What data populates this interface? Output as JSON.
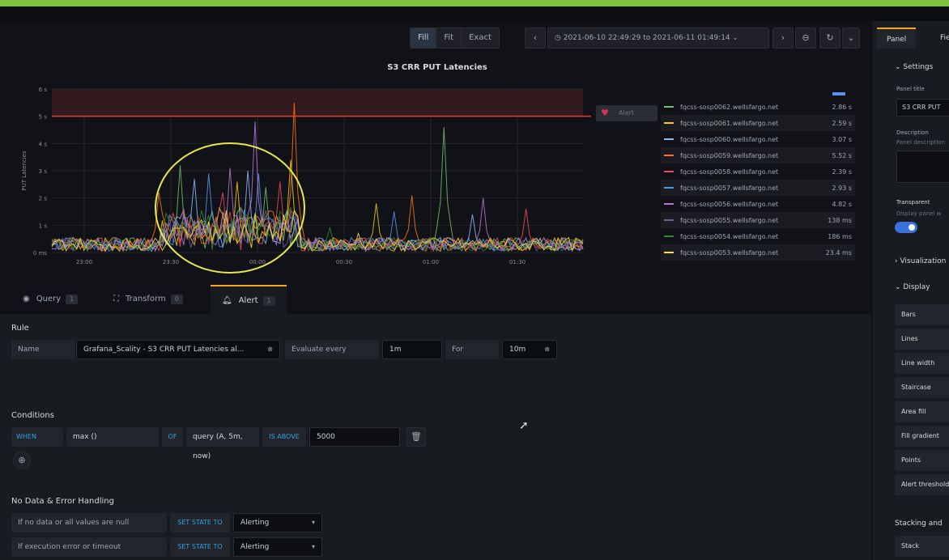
{
  "toolbar": {
    "view_buttons": [
      "Fill",
      "Fit",
      "Exact"
    ],
    "time_range": "2021-06-10 22:49:29 to 2021-06-11 01:49:14",
    "prev_icon": "chevron-left-icon",
    "next_icon": "chevron-right-icon",
    "zoom_icon": "zoom-out-icon",
    "refresh_icon": "refresh-icon",
    "more_icon": "chevron-down-icon"
  },
  "chart": {
    "title": "S3 CRR PUT Latencies"
  },
  "chart_data": {
    "type": "line",
    "title": "S3 CRR PUT Latencies",
    "ylabel": "PUT Latencies",
    "xlabel": "",
    "x_ticks": [
      "23:00",
      "23:30",
      "00:00",
      "00:30",
      "01:00",
      "01:30"
    ],
    "y_ticks": [
      "0 ms",
      "1 s",
      "2 s",
      "3 s",
      "4 s",
      "5 s",
      "6 s"
    ],
    "ylim": [
      0,
      6
    ],
    "threshold": 5,
    "grid": true,
    "legend_placement": "right",
    "series": [
      {
        "name": "fqcss-sosp0062.wellsfargo.net",
        "value": "2.86 s",
        "color": "#73bf69"
      },
      {
        "name": "fqcss-sosp0061.wellsfargo.net",
        "value": "2.59 s",
        "color": "#f2cc0c"
      },
      {
        "name": "fqcss-sosp0060.wellsfargo.net",
        "value": "3.07 s",
        "color": "#8ab8ff"
      },
      {
        "name": "fqcss-sosp0059.wellsfargo.net",
        "value": "5.52 s",
        "color": "#ff780a"
      },
      {
        "name": "fqcss-sosp0058.wellsfargo.net",
        "value": "2.39 s",
        "color": "#f2495c"
      },
      {
        "name": "fqcss-sosp0057.wellsfargo.net",
        "value": "2.93 s",
        "color": "#5794f2"
      },
      {
        "name": "fqcss-sosp0056.wellsfargo.net",
        "value": "4.82 s",
        "color": "#b877d9"
      },
      {
        "name": "fqcss-sosp0055.wellsfargo.net",
        "value": "138 ms",
        "color": "#705da0"
      },
      {
        "name": "fqcss-sosp0054.wellsfargo.net",
        "value": "186 ms",
        "color": "#37872d"
      },
      {
        "name": "fqcss-sosp0053.wellsfargo.net",
        "value": "23.4 ms",
        "color": "#fade2a"
      }
    ]
  },
  "alert_tag": {
    "label": "Alert",
    "icon": "heart-icon"
  },
  "tabs": [
    {
      "label": "Query",
      "count": "1",
      "icon": "database-icon"
    },
    {
      "label": "Transform",
      "count": "0",
      "icon": "transform-icon"
    },
    {
      "label": "Alert",
      "count": "1",
      "icon": "bell-icon"
    }
  ],
  "rule": {
    "section": "Rule",
    "name_label": "Name",
    "name_value": "Grafana_Scality - S3 CRR PUT Latencies al...",
    "evaluate_label": "Evaluate every",
    "evaluate_value": "1m",
    "for_label": "For",
    "for_value": "10m"
  },
  "conditions": {
    "section": "Conditions",
    "when": "WHEN",
    "func": "max ()",
    "of": "OF",
    "query": "query (A, 5m, now)",
    "is_above": "IS ABOVE",
    "value": "5000",
    "delete_icon": "trash-icon",
    "add_icon": "plus-circle-icon"
  },
  "nodata": {
    "section": "No Data & Error Handling",
    "rows": [
      {
        "label": "If no data or all values are null",
        "kw": "SET STATE TO",
        "value": "Alerting"
      },
      {
        "label": "If execution error or timeout",
        "kw": "SET STATE TO",
        "value": "Alerting"
      }
    ]
  },
  "sidepanel": {
    "tabs": [
      "Panel",
      "Fie"
    ],
    "settings": "Settings",
    "panel_title_label": "Panel title",
    "panel_title_value": "S3 CRR PUT",
    "description_label": "Description",
    "description_placeholder": "Panel description",
    "transparent_label": "Transparent",
    "transparent_hint": "Display panel w",
    "visualization": "Visualization",
    "display": "Display",
    "display_rows": [
      "Bars",
      "Lines",
      "Line width",
      "Staircase",
      "Area fill",
      "Fill gradient",
      "Points",
      "Alert thresholds"
    ],
    "stacking": "Stacking and",
    "stack": "Stack"
  }
}
